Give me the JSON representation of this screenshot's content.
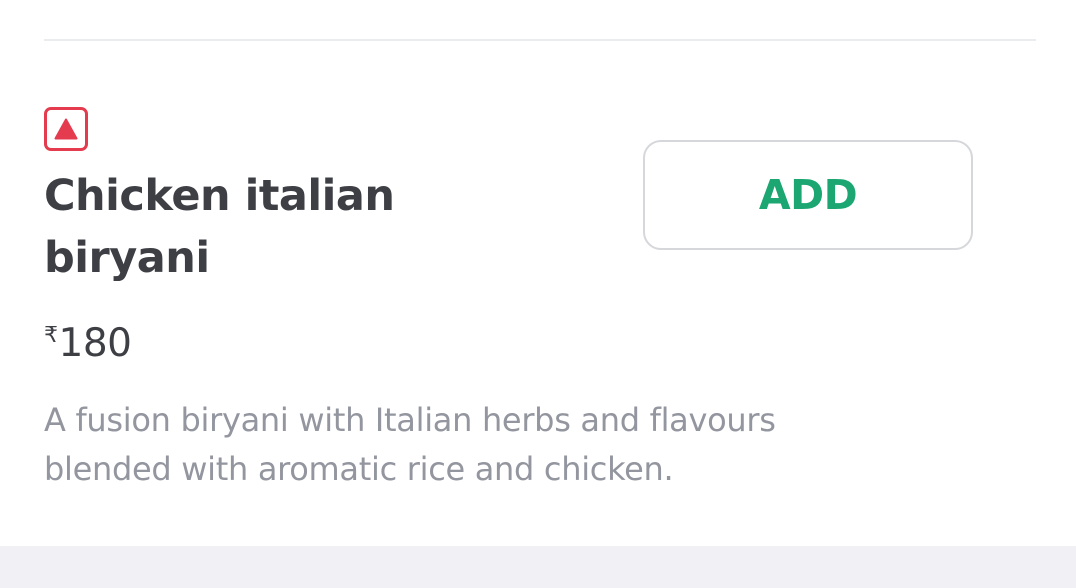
{
  "item": {
    "veg_indicator_icon": "non-veg-triangle-icon",
    "name": "Chicken italian biryani",
    "price_currency": "₹",
    "price_value": "180",
    "description": "A fusion biryani with Italian herbs and flavours blended with aromatic rice and chicken.",
    "add_label": "ADD"
  },
  "colors": {
    "non_veg_indicator": "#e43b4f",
    "add_text": "#1ba672",
    "title_text": "#3d3f45",
    "description_text": "#93959f",
    "button_border": "#d6d7da",
    "footer_band": "#f1f1f5"
  }
}
